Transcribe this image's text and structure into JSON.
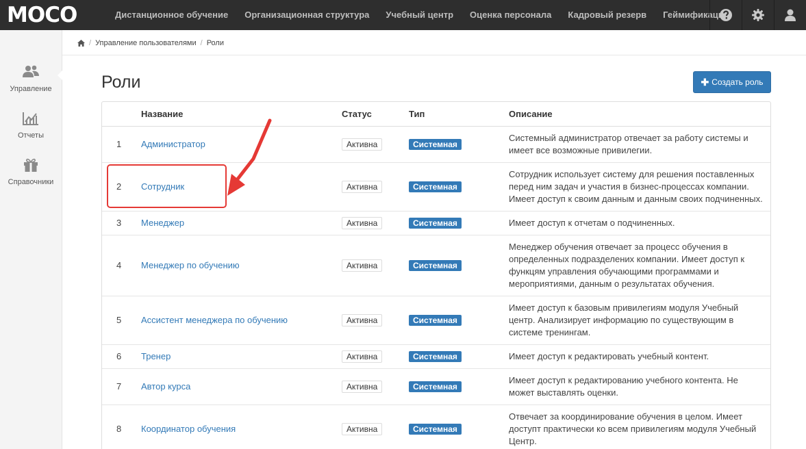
{
  "app": {
    "logo": "MOCO",
    "nav": [
      "Дистанционное обучение",
      "Организационная структура",
      "Учебный центр",
      "Оценка персонала",
      "Кадровый резерв",
      "Геймификация"
    ],
    "nav_icons": [
      "help-icon",
      "gear-icon",
      "user-icon"
    ]
  },
  "sidebar": {
    "items": [
      {
        "label": "Управление",
        "icon": "users-icon"
      },
      {
        "label": "Отчеты",
        "icon": "chart-icon"
      },
      {
        "label": "Справочники",
        "icon": "gift-icon"
      }
    ]
  },
  "breadcrumb": {
    "home_icon": "home-icon",
    "items": [
      "Управление пользователями",
      "Роли"
    ],
    "separator": "/"
  },
  "page": {
    "title": "Роли",
    "create_button": "Создать роль"
  },
  "table": {
    "headers": {
      "num": "",
      "name": "Название",
      "status": "Статус",
      "type": "Тип",
      "description": "Описание"
    },
    "rows": [
      {
        "num": "1",
        "name": "Администратор",
        "status": "Активна",
        "type": "Системная",
        "description": "Системный администратор отвечает за работу системы и имеет все возможные привилегии."
      },
      {
        "num": "2",
        "name": "Сотрудник",
        "status": "Активна",
        "type": "Системная",
        "description": "Сотрудник использует систему для решения поставленных перед ним задач и участия в бизнес-процессах компании. Имеет доступ к своим данным и данным своих подчиненных."
      },
      {
        "num": "3",
        "name": "Менеджер",
        "status": "Активна",
        "type": "Системная",
        "description": "Имеет доступ к отчетам о подчиненных."
      },
      {
        "num": "4",
        "name": "Менеджер по обучению",
        "status": "Активна",
        "type": "Системная",
        "description": "Менеджер обучения отвечает за процесс обучения в определенных подразделених компании. Имеет доступ к функцям управления обучающими программами и мероприятиями, данным о результатах обучения."
      },
      {
        "num": "5",
        "name": "Ассистент менеджера по обучению",
        "status": "Активна",
        "type": "Системная",
        "description": "Имеет доступ к базовым привилегиям модуля Учебный центр. Анализирует информацию по существующим в системе тренингам."
      },
      {
        "num": "6",
        "name": "Тренер",
        "status": "Активна",
        "type": "Системная",
        "description": "Имеет доступ к редактировать учебный контент."
      },
      {
        "num": "7",
        "name": "Автор курса",
        "status": "Активна",
        "type": "Системная",
        "description": "Имеет доступ к редактированию учебного контента. Не может выставлять оценки."
      },
      {
        "num": "8",
        "name": "Координатор обучения",
        "status": "Активна",
        "type": "Системная",
        "description": "Отвечает за координирование обучения в целом. Имеет доступт практически ко всем привилегиям модуля Учебный Центр."
      }
    ]
  },
  "colors": {
    "topbar": "#2e2e2e",
    "accent": "#337ab7",
    "annotation": "#e53935"
  }
}
